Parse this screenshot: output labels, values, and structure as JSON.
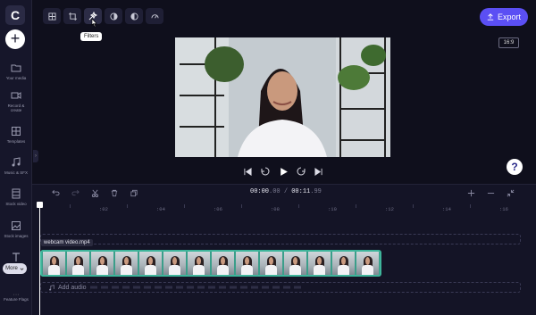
{
  "sidebar": {
    "logo_text": "C",
    "add_label": "+",
    "items": [
      {
        "label": "Your media",
        "icon": "folder-icon"
      },
      {
        "label": "Record & create",
        "icon": "video-camera-icon"
      },
      {
        "label": "Templates",
        "icon": "grid-icon"
      },
      {
        "label": "Music & SFX",
        "icon": "music-note-icon"
      },
      {
        "label": "Stock video",
        "icon": "film-icon"
      },
      {
        "label": "Stock images",
        "icon": "image-icon"
      },
      {
        "label": "Text",
        "icon": "text-icon"
      }
    ],
    "more_label": "More",
    "feature_flags_label": "Feature Flags"
  },
  "toolbar": {
    "tools": [
      "fit-icon",
      "crop-icon",
      "filters-icon",
      "adjust-icon",
      "fade-icon",
      "speed-icon"
    ],
    "tooltip": "Filters",
    "export_label": "Export",
    "aspect_ratio": "16:9"
  },
  "player": {
    "help_label": "?"
  },
  "timeline": {
    "current_time_main": "00:00",
    "current_time_frac": ".00",
    "separator": " / ",
    "total_time_main": "00:11",
    "total_time_frac": ".99",
    "ticks": [
      ":02",
      ":04",
      ":06",
      ":08",
      ":10",
      ":12",
      ":14",
      ":16"
    ],
    "clip_name": "webcam video.mp4",
    "add_audio_label": "Add audio"
  },
  "colors": {
    "accent": "#5b4ff4",
    "clip_border": "#3fb59b",
    "background": "#0f0f1c"
  }
}
